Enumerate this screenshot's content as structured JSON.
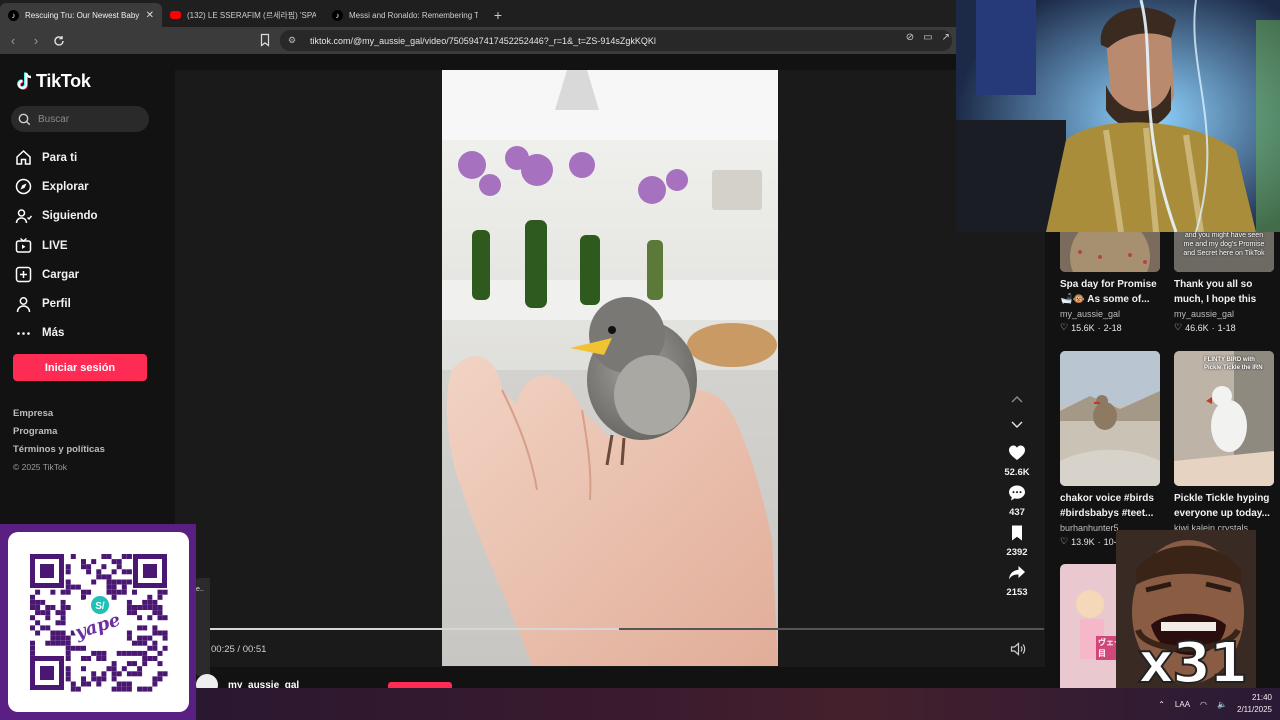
{
  "browser": {
    "tabs": [
      {
        "label": "Rescuing Tru: Our Newest Baby B",
        "active": true
      },
      {
        "label": "(132) LE SSERAFIM (르세라핌) 'SPAG",
        "active": false
      },
      {
        "label": "Messi and Ronaldo: Remembering Th",
        "active": false
      }
    ],
    "url": "tiktok.com/@my_aussie_gal/video/7505947417452252446?_r=1&_t=ZS-914sZgkKQKl"
  },
  "sidebar": {
    "logo_text": "TikTok",
    "search_placeholder": "Buscar",
    "nav": [
      {
        "label": "Para ti",
        "icon": "home-icon"
      },
      {
        "label": "Explorar",
        "icon": "compass-icon"
      },
      {
        "label": "Siguiendo",
        "icon": "following-icon"
      },
      {
        "label": "LIVE",
        "icon": "live-icon"
      },
      {
        "label": "Cargar",
        "icon": "upload-icon"
      },
      {
        "label": "Perfil",
        "icon": "profile-icon"
      },
      {
        "label": "Más",
        "icon": "more-icon"
      }
    ],
    "login_label": "Iniciar sesión",
    "footer": [
      "Empresa",
      "Programa",
      "Términos y políticas"
    ],
    "copyright": "© 2025 TikTok"
  },
  "player": {
    "time": "00:25 / 00:51",
    "progress": 0.49,
    "author": "my_aussie_gal"
  },
  "actions": {
    "likes": "52.6K",
    "comments": "437",
    "saves": "2392",
    "shares": "2153"
  },
  "cards": [
    {
      "title": "Spa day for Promise 🛁🐵 As some of...",
      "user": "my_aussie_gal",
      "likes": "15.6K",
      "date": "2-18"
    },
    {
      "title": "Thank you all so much, I hope this is...",
      "user": "my_aussie_gal",
      "likes": "46.6K",
      "date": "1-18",
      "thumb_text": "and you might have seen me and my dog's Promise and Secret here on TikTok"
    },
    {
      "title": "chakor voice #birds #birdsbabys #teet...",
      "user": "burhanhunter5",
      "likes": "13.9K",
      "date": "10-"
    },
    {
      "title": "Pickle Tickle hyping everyone up today...",
      "user": "kiwi.kalein.crystals",
      "likes": "",
      "date": "",
      "thumb_text": "FLINTY BIRD with Pickle Tickle the IRN"
    },
    {
      "thumb_text": "ヴェーデ 102日目"
    }
  ],
  "overlay": {
    "qr_brand": "yape",
    "meme_caption": "x31"
  },
  "taskbar": {
    "lang": "LAA",
    "time": "21:40",
    "date": "2/11/2025"
  }
}
